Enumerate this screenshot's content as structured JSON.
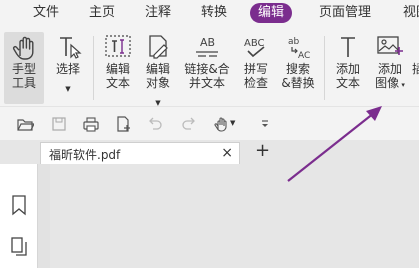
{
  "menubar": {
    "items": [
      "文件",
      "主页",
      "注释",
      "转换",
      "编辑",
      "页面管理",
      "视图"
    ],
    "active": "编辑",
    "accent": "#7b2d8e"
  },
  "ribbon": {
    "tools": [
      {
        "label": "手型\n工具",
        "icon": "hand-icon"
      },
      {
        "label": "选择",
        "icon": "select-cursor-icon"
      },
      {
        "label": "编辑\n文本",
        "icon": "edit-text-icon"
      },
      {
        "label": "编辑\n对象",
        "icon": "edit-object-icon"
      },
      {
        "label": "链接&合\n并文本",
        "icon": "link-merge-text-icon"
      },
      {
        "label": "拼写\n检查",
        "icon": "spell-check-icon"
      },
      {
        "label": "搜索\n&替换",
        "icon": "search-replace-icon"
      },
      {
        "label": "添加\n文本",
        "icon": "add-text-icon"
      },
      {
        "label": "添加\n图像",
        "icon": "add-image-icon"
      },
      {
        "label": "插",
        "icon": "insert-icon"
      }
    ]
  },
  "tabs": {
    "doc_title": "福昕软件.pdf",
    "close_glyph": "×",
    "new_glyph": "+"
  },
  "colors": {
    "arrow": "#7b2d8e"
  }
}
